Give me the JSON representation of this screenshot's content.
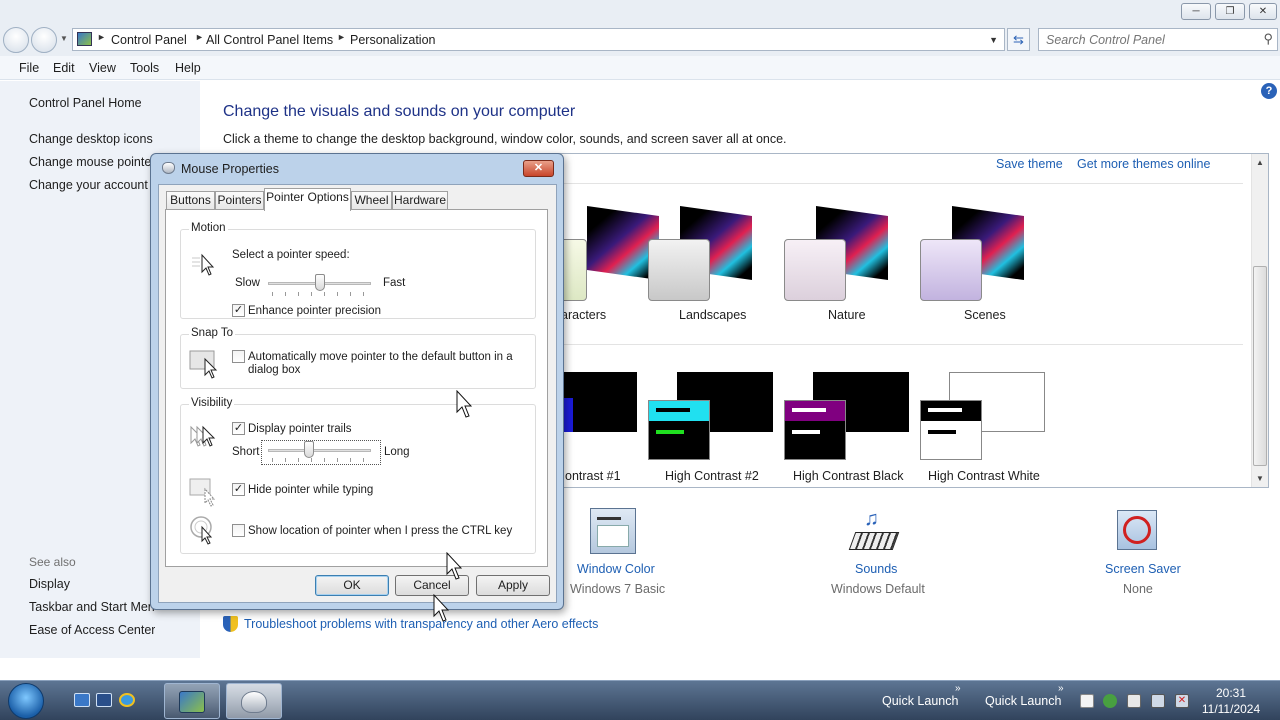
{
  "window": {
    "minimize_icon": "minimize-icon",
    "maximize_icon": "restore-icon",
    "close_icon": "close-icon"
  },
  "address": {
    "crumbs": [
      "Control Panel",
      "All Control Panel Items",
      "Personalization"
    ],
    "search_placeholder": "Search Control Panel"
  },
  "menu": [
    "File",
    "Edit",
    "View",
    "Tools",
    "Help"
  ],
  "sidebar": {
    "home": "Control Panel Home",
    "links": [
      "Change desktop icons",
      "Change mouse pointers",
      "Change your account picture"
    ],
    "see_also_title": "See also",
    "see_also": [
      "Display",
      "Taskbar and Start Menu",
      "Ease of Access Center"
    ]
  },
  "main": {
    "title": "Change the visuals and sounds on your computer",
    "subtitle": "Click a theme to change the desktop background, window color, sounds, and screen saver all at once.",
    "save_theme": "Save theme",
    "get_more": "Get more themes online",
    "aero_themes": [
      "aracters",
      "Landscapes",
      "Nature",
      "Scenes"
    ],
    "contrast_themes": [
      "ontrast #1",
      "High Contrast #2",
      "High Contrast Black",
      "High Contrast White"
    ],
    "tiles": [
      {
        "label": "Window Color",
        "value": "Windows 7 Basic"
      },
      {
        "label": "Sounds",
        "value": "Windows Default"
      },
      {
        "label": "Screen Saver",
        "value": "None"
      }
    ],
    "troubleshoot": "Troubleshoot problems with transparency and other Aero effects"
  },
  "dialog": {
    "title": "Mouse Properties",
    "tabs": [
      "Buttons",
      "Pointers",
      "Pointer Options",
      "Wheel",
      "Hardware"
    ],
    "active_tab": "Pointer Options",
    "motion": {
      "group": "Motion",
      "prompt": "Select a pointer speed:",
      "slow": "Slow",
      "fast": "Fast",
      "speed_level": 0.5,
      "precision_label": "Enhance pointer precision",
      "precision_checked": true
    },
    "snap": {
      "group": "Snap To",
      "label": "Automatically move pointer to the default button in a dialog box",
      "checked": false
    },
    "visibility": {
      "group": "Visibility",
      "trails_label": "Display pointer trails",
      "trails_checked": true,
      "short": "Short",
      "long": "Long",
      "trail_level": 0.4,
      "hide_label": "Hide pointer while typing",
      "hide_checked": true,
      "ctrl_label": "Show location of pointer when I press the CTRL key",
      "ctrl_checked": false
    },
    "ok": "OK",
    "cancel": "Cancel",
    "apply": "Apply"
  },
  "taskbar": {
    "quick_launch_1": "Quick Launch",
    "quick_launch_2": "Quick Launch",
    "time": "20:31",
    "date": "11/11/2024"
  }
}
